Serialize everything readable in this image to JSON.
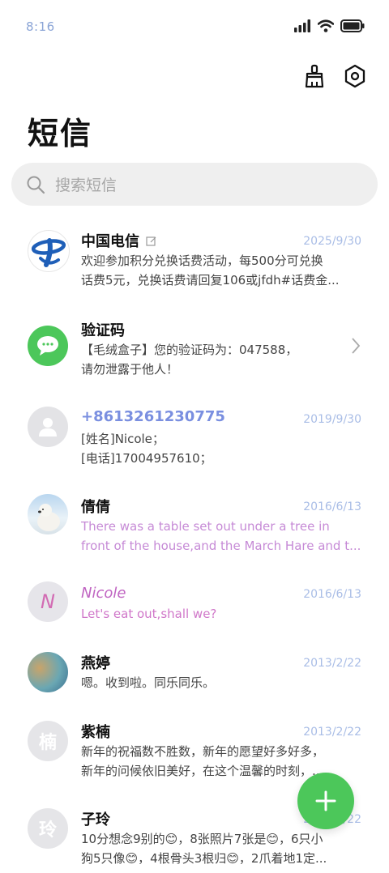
{
  "status": {
    "time": "8:16"
  },
  "header": {
    "title": "短信"
  },
  "search": {
    "placeholder": "搜索短信"
  },
  "messages": [
    {
      "name": "中国电信",
      "date": "2025/9/30",
      "line1": "欢迎参加积分兑换话费活动，每500分可兑换",
      "line2": "话费5元，兑换话费请回复106或jfdh#话费金..."
    },
    {
      "name": "验证码",
      "line1": "【毛绒盒子】您的验证码为：047588，",
      "line2": "请勿泄露于他人！"
    },
    {
      "name": "+8613261230775",
      "date": "2019/9/30",
      "line1": "[姓名]Nicole；",
      "line2": "[电话]17004957610；"
    },
    {
      "name": "倩倩",
      "date": "2016/6/13",
      "line1": "There was a table set out under a tree in",
      "line2": "front of the house,and the March Hare and t..."
    },
    {
      "name": "Nicole",
      "avatar_letter": "N",
      "date": "2016/6/13",
      "line1": "Let's eat out,shall we?"
    },
    {
      "name": "燕婷",
      "date": "2013/2/22",
      "line1": "嗯。收到啦。同乐同乐。"
    },
    {
      "name": "紫楠",
      "avatar_letter": "楠",
      "date": "2013/2/22",
      "line1": "新年的祝福数不胜数，新年的愿望好多好多，",
      "line2": "新年的问候依旧美好，在这个温馨的时刻，..."
    },
    {
      "name": "子玲",
      "avatar_letter": "玲",
      "date": "2013/2/22",
      "line1": "10分想念9别的😊，8张照片7张是😊，6只小",
      "line2": "狗5只像😊，4根骨头3根归😊，2爪着地1定..."
    }
  ],
  "colors": {
    "accent_green": "#4cc75a",
    "date_blue": "#a9bde6",
    "search_bg": "#efefef"
  },
  "icons": [
    "signal-icon",
    "wifi-icon",
    "battery-icon",
    "broom-icon",
    "settings-icon",
    "search-icon",
    "chevron-right-icon",
    "plus-icon"
  ]
}
